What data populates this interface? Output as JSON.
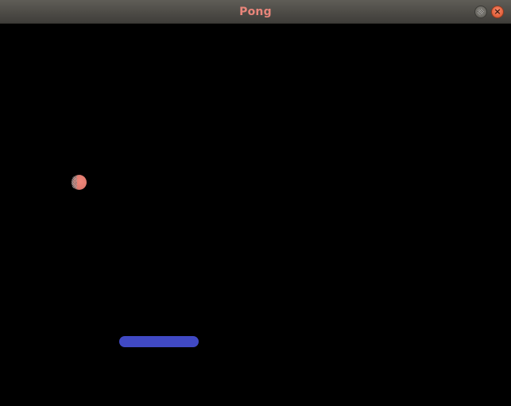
{
  "window": {
    "title": "Pong",
    "title_color": "#e8857a",
    "controls": {
      "minimize_icon": "minimize-icon",
      "close_icon": "close-icon",
      "close_glyph": "×"
    }
  },
  "game": {
    "background_color": "#000000",
    "ball": {
      "color": "#e07a6e",
      "icon": "ball"
    },
    "paddle": {
      "color": "#4049c4"
    }
  }
}
